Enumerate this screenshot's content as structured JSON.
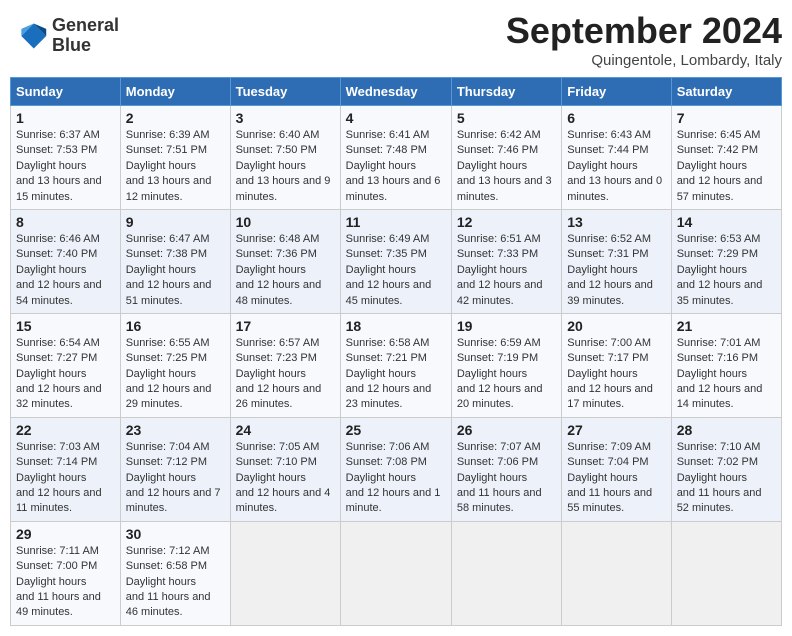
{
  "logo": {
    "line1": "General",
    "line2": "Blue"
  },
  "title": "September 2024",
  "subtitle": "Quingentole, Lombardy, Italy",
  "days_of_week": [
    "Sunday",
    "Monday",
    "Tuesday",
    "Wednesday",
    "Thursday",
    "Friday",
    "Saturday"
  ],
  "weeks": [
    [
      {
        "day": 1,
        "sunrise": "6:37 AM",
        "sunset": "7:53 PM",
        "daylight": "13 hours and 15 minutes."
      },
      {
        "day": 2,
        "sunrise": "6:39 AM",
        "sunset": "7:51 PM",
        "daylight": "13 hours and 12 minutes."
      },
      {
        "day": 3,
        "sunrise": "6:40 AM",
        "sunset": "7:50 PM",
        "daylight": "13 hours and 9 minutes."
      },
      {
        "day": 4,
        "sunrise": "6:41 AM",
        "sunset": "7:48 PM",
        "daylight": "13 hours and 6 minutes."
      },
      {
        "day": 5,
        "sunrise": "6:42 AM",
        "sunset": "7:46 PM",
        "daylight": "13 hours and 3 minutes."
      },
      {
        "day": 6,
        "sunrise": "6:43 AM",
        "sunset": "7:44 PM",
        "daylight": "13 hours and 0 minutes."
      },
      {
        "day": 7,
        "sunrise": "6:45 AM",
        "sunset": "7:42 PM",
        "daylight": "12 hours and 57 minutes."
      }
    ],
    [
      {
        "day": 8,
        "sunrise": "6:46 AM",
        "sunset": "7:40 PM",
        "daylight": "12 hours and 54 minutes."
      },
      {
        "day": 9,
        "sunrise": "6:47 AM",
        "sunset": "7:38 PM",
        "daylight": "12 hours and 51 minutes."
      },
      {
        "day": 10,
        "sunrise": "6:48 AM",
        "sunset": "7:36 PM",
        "daylight": "12 hours and 48 minutes."
      },
      {
        "day": 11,
        "sunrise": "6:49 AM",
        "sunset": "7:35 PM",
        "daylight": "12 hours and 45 minutes."
      },
      {
        "day": 12,
        "sunrise": "6:51 AM",
        "sunset": "7:33 PM",
        "daylight": "12 hours and 42 minutes."
      },
      {
        "day": 13,
        "sunrise": "6:52 AM",
        "sunset": "7:31 PM",
        "daylight": "12 hours and 39 minutes."
      },
      {
        "day": 14,
        "sunrise": "6:53 AM",
        "sunset": "7:29 PM",
        "daylight": "12 hours and 35 minutes."
      }
    ],
    [
      {
        "day": 15,
        "sunrise": "6:54 AM",
        "sunset": "7:27 PM",
        "daylight": "12 hours and 32 minutes."
      },
      {
        "day": 16,
        "sunrise": "6:55 AM",
        "sunset": "7:25 PM",
        "daylight": "12 hours and 29 minutes."
      },
      {
        "day": 17,
        "sunrise": "6:57 AM",
        "sunset": "7:23 PM",
        "daylight": "12 hours and 26 minutes."
      },
      {
        "day": 18,
        "sunrise": "6:58 AM",
        "sunset": "7:21 PM",
        "daylight": "12 hours and 23 minutes."
      },
      {
        "day": 19,
        "sunrise": "6:59 AM",
        "sunset": "7:19 PM",
        "daylight": "12 hours and 20 minutes."
      },
      {
        "day": 20,
        "sunrise": "7:00 AM",
        "sunset": "7:17 PM",
        "daylight": "12 hours and 17 minutes."
      },
      {
        "day": 21,
        "sunrise": "7:01 AM",
        "sunset": "7:16 PM",
        "daylight": "12 hours and 14 minutes."
      }
    ],
    [
      {
        "day": 22,
        "sunrise": "7:03 AM",
        "sunset": "7:14 PM",
        "daylight": "12 hours and 11 minutes."
      },
      {
        "day": 23,
        "sunrise": "7:04 AM",
        "sunset": "7:12 PM",
        "daylight": "12 hours and 7 minutes."
      },
      {
        "day": 24,
        "sunrise": "7:05 AM",
        "sunset": "7:10 PM",
        "daylight": "12 hours and 4 minutes."
      },
      {
        "day": 25,
        "sunrise": "7:06 AM",
        "sunset": "7:08 PM",
        "daylight": "12 hours and 1 minute."
      },
      {
        "day": 26,
        "sunrise": "7:07 AM",
        "sunset": "7:06 PM",
        "daylight": "11 hours and 58 minutes."
      },
      {
        "day": 27,
        "sunrise": "7:09 AM",
        "sunset": "7:04 PM",
        "daylight": "11 hours and 55 minutes."
      },
      {
        "day": 28,
        "sunrise": "7:10 AM",
        "sunset": "7:02 PM",
        "daylight": "11 hours and 52 minutes."
      }
    ],
    [
      {
        "day": 29,
        "sunrise": "7:11 AM",
        "sunset": "7:00 PM",
        "daylight": "11 hours and 49 minutes."
      },
      {
        "day": 30,
        "sunrise": "7:12 AM",
        "sunset": "6:58 PM",
        "daylight": "11 hours and 46 minutes."
      },
      null,
      null,
      null,
      null,
      null
    ]
  ]
}
